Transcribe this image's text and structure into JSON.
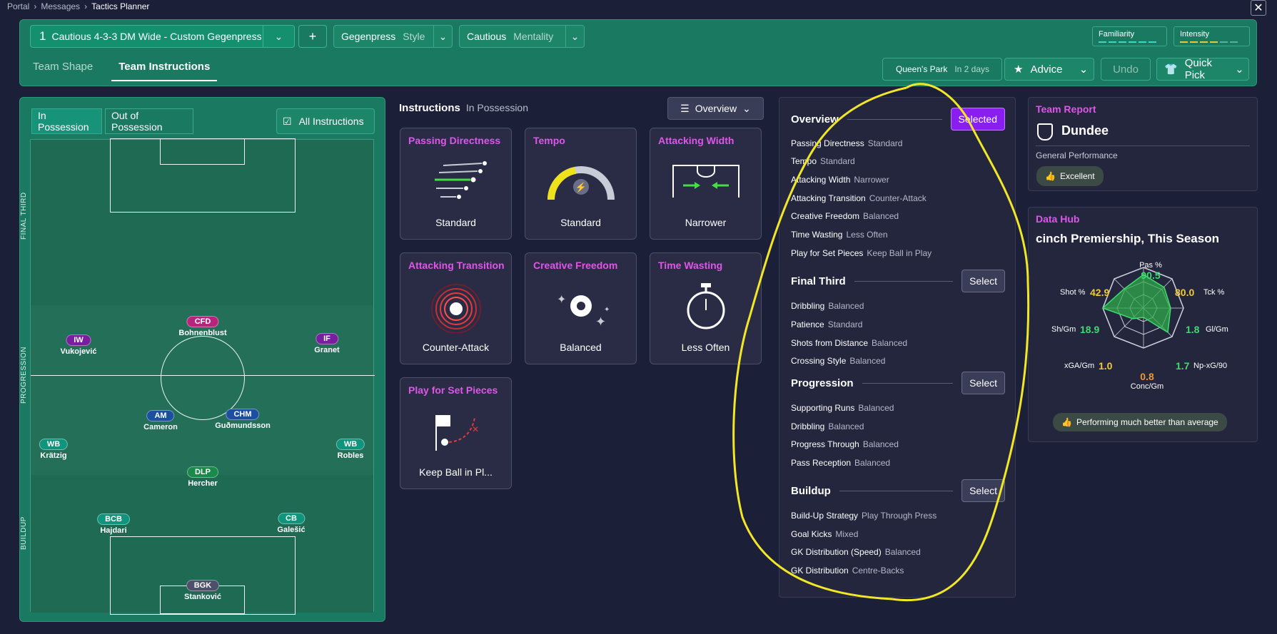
{
  "breadcrumb": [
    "Portal",
    "Messages",
    "Tactics Planner"
  ],
  "top": {
    "number": "1",
    "tactic_name": "Cautious 4-3-3 DM Wide - Custom Gegenpress",
    "style_value": "Gegenpress",
    "style_label": "Style",
    "mentality_value": "Cautious",
    "mentality_label": "Mentality",
    "familiarity_label": "Familiarity",
    "intensity_label": "Intensity",
    "plus": "+"
  },
  "tabs": [
    "Team Shape",
    "Team Instructions"
  ],
  "next_match": {
    "opponent": "Queen's Park",
    "when": "In 2 days"
  },
  "buttons": {
    "advice": "Advice",
    "undo": "Undo",
    "quick_pick": "Quick Pick"
  },
  "pitch_panel": {
    "in_possession": "In Possession",
    "out_of_possession": "Out of Possession",
    "all_instructions": "All Instructions",
    "zones": [
      "FINAL THIRD",
      "PROGRESSION",
      "BUILDUP"
    ]
  },
  "players": [
    {
      "pos": "CFD",
      "name": "Bohnenblust",
      "color": "#b8237e"
    },
    {
      "pos": "IW",
      "name": "Vukojević",
      "color": "#7a1ea0"
    },
    {
      "pos": "IF",
      "name": "Granet",
      "color": "#7a1ea0"
    },
    {
      "pos": "AM",
      "name": "Cameron",
      "color": "#1d4fa0"
    },
    {
      "pos": "CHM",
      "name": "Guðmundsson",
      "color": "#1d4fa0"
    },
    {
      "pos": "WB",
      "name": "Krätzig",
      "color": "#11947c"
    },
    {
      "pos": "WB",
      "name": "Robles",
      "color": "#11947c"
    },
    {
      "pos": "DLP",
      "name": "Hercher",
      "color": "#1a8a4a"
    },
    {
      "pos": "BCB",
      "name": "Hajdari",
      "color": "#11947c"
    },
    {
      "pos": "CB",
      "name": "Galešić",
      "color": "#11947c"
    },
    {
      "pos": "BGK",
      "name": "Stanković",
      "color": "#4d4f6b"
    }
  ],
  "instructions": {
    "title": "Instructions",
    "subtitle": "In Possession",
    "view": "Overview",
    "cards": [
      {
        "title": "Passing Directness",
        "value": "Standard"
      },
      {
        "title": "Tempo",
        "value": "Standard"
      },
      {
        "title": "Attacking Width",
        "value": "Narrower"
      },
      {
        "title": "Attacking Transition",
        "value": "Counter-Attack"
      },
      {
        "title": "Creative Freedom",
        "value": "Balanced"
      },
      {
        "title": "Time Wasting",
        "value": "Less Often"
      },
      {
        "title": "Play for Set Pieces",
        "value": "Keep Ball in Pl..."
      }
    ]
  },
  "overview": {
    "sections": [
      {
        "title": "Overview",
        "button": "Selected",
        "rows": [
          [
            "Passing Directness",
            "Standard"
          ],
          [
            "Tempo",
            "Standard"
          ],
          [
            "Attacking Width",
            "Narrower"
          ],
          [
            "Attacking Transition",
            "Counter-Attack"
          ],
          [
            "Creative Freedom",
            "Balanced"
          ],
          [
            "Time Wasting",
            "Less Often"
          ],
          [
            "Play for Set Pieces",
            "Keep Ball in Play"
          ]
        ]
      },
      {
        "title": "Final Third",
        "button": "Select",
        "rows": [
          [
            "Dribbling",
            "Balanced"
          ],
          [
            "Patience",
            "Standard"
          ],
          [
            "Shots from Distance",
            "Balanced"
          ],
          [
            "Crossing Style",
            "Balanced"
          ]
        ]
      },
      {
        "title": "Progression",
        "button": "Select",
        "rows": [
          [
            "Supporting Runs",
            "Balanced"
          ],
          [
            "Dribbling",
            "Balanced"
          ],
          [
            "Progress Through",
            "Balanced"
          ],
          [
            "Pass Reception",
            "Balanced"
          ]
        ]
      },
      {
        "title": "Buildup",
        "button": "Select",
        "rows": [
          [
            "Build-Up Strategy",
            "Play Through Press"
          ],
          [
            "Goal Kicks",
            "Mixed"
          ],
          [
            "GK Distribution (Speed)",
            "Balanced"
          ],
          [
            "GK Distribution",
            "Centre-Backs"
          ]
        ]
      }
    ]
  },
  "team_report": {
    "title": "Team Report",
    "team": "Dundee",
    "label": "General Performance",
    "rating": "Excellent"
  },
  "data_hub": {
    "title": "Data Hub",
    "competition": "cinch Premiership, This Season",
    "radar": [
      {
        "label": "Pas %",
        "value": "90.5",
        "color": "#3ddc6c"
      },
      {
        "label": "Tck %",
        "value": "80.0",
        "color": "#f0c93a"
      },
      {
        "label": "Gl/Gm",
        "value": "1.8",
        "color": "#3ddc6c"
      },
      {
        "label": "Np-xG/90",
        "value": "1.7",
        "color": "#3ddc6c"
      },
      {
        "label": "Conc/Gm",
        "value": "0.8",
        "color": "#f0963a"
      },
      {
        "label": "xGA/Gm",
        "value": "1.0",
        "color": "#f0c93a"
      },
      {
        "label": "Sh/Gm",
        "value": "18.9",
        "color": "#3ddc6c"
      },
      {
        "label": "Shot %",
        "value": "42.9",
        "color": "#f0c93a"
      }
    ],
    "footer": "Performing much better than average"
  }
}
